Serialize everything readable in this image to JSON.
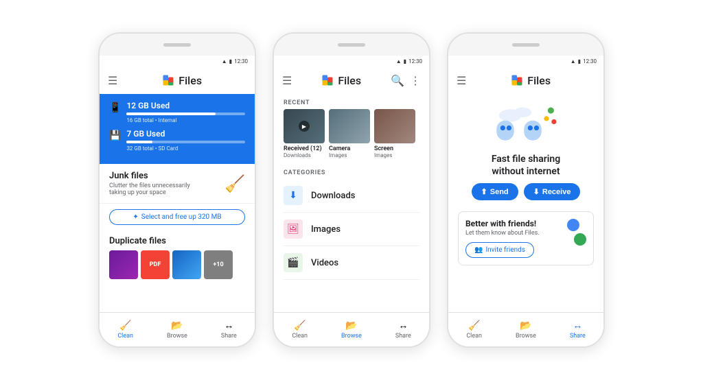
{
  "page": {
    "background": "#ffffff"
  },
  "phones": [
    {
      "id": "phone1",
      "statusBar": {
        "time": "12:30"
      },
      "header": {
        "title": "Files",
        "hasMenu": true,
        "hasSearch": false,
        "hasMore": false
      },
      "storage": [
        {
          "label": "12 GB Used",
          "sub": "16 GB total • Internal",
          "fillPercent": 75
        },
        {
          "label": "7 GB Used",
          "sub": "32 GB total • SD Card",
          "fillPercent": 22
        }
      ],
      "junk": {
        "title": "Junk files",
        "description": "Clutter the files unnecessarily taking up your space",
        "freeUpLabel": "Select and free up 320 MB"
      },
      "duplicate": {
        "title": "Duplicate files",
        "thumbs": [
          "grape",
          "pdf",
          "blue",
          "+10"
        ]
      },
      "nav": [
        {
          "label": "Clean",
          "active": true
        },
        {
          "label": "Browse",
          "active": false
        },
        {
          "label": "Share",
          "active": false
        }
      ]
    },
    {
      "id": "phone2",
      "statusBar": {
        "time": "12:30"
      },
      "header": {
        "title": "Files",
        "hasMenu": true,
        "hasSearch": true,
        "hasMore": true
      },
      "recent": {
        "sectionLabel": "RECENT",
        "items": [
          {
            "name": "Received (12)",
            "sub": "Downloads",
            "type": "received"
          },
          {
            "name": "Camera",
            "sub": "Images",
            "type": "camera"
          },
          {
            "name": "Screen",
            "sub": "Images",
            "type": "screen"
          }
        ]
      },
      "categories": {
        "sectionLabel": "CATEGORIES",
        "items": [
          {
            "name": "Downloads",
            "icon": "⬇",
            "color": "downloads"
          },
          {
            "name": "Images",
            "icon": "🖼",
            "color": "images"
          },
          {
            "name": "Videos",
            "icon": "🎬",
            "color": "videos"
          }
        ]
      },
      "nav": [
        {
          "label": "Clean",
          "active": false
        },
        {
          "label": "Browse",
          "active": true
        },
        {
          "label": "Share",
          "active": false
        }
      ]
    },
    {
      "id": "phone3",
      "statusBar": {
        "time": "12:30"
      },
      "header": {
        "title": "Files",
        "hasMenu": true,
        "hasSearch": false,
        "hasMore": false
      },
      "sharing": {
        "title": "Fast file sharing\nwithout internet",
        "sendLabel": "Send",
        "receiveLabel": "Receive"
      },
      "friends": {
        "title": "Better with friends!",
        "description": "Let them know about Files.",
        "inviteLabel": "Invite friends"
      },
      "nav": [
        {
          "label": "Clean",
          "active": false
        },
        {
          "label": "Browse",
          "active": false
        },
        {
          "label": "Share",
          "active": true
        }
      ]
    }
  ]
}
